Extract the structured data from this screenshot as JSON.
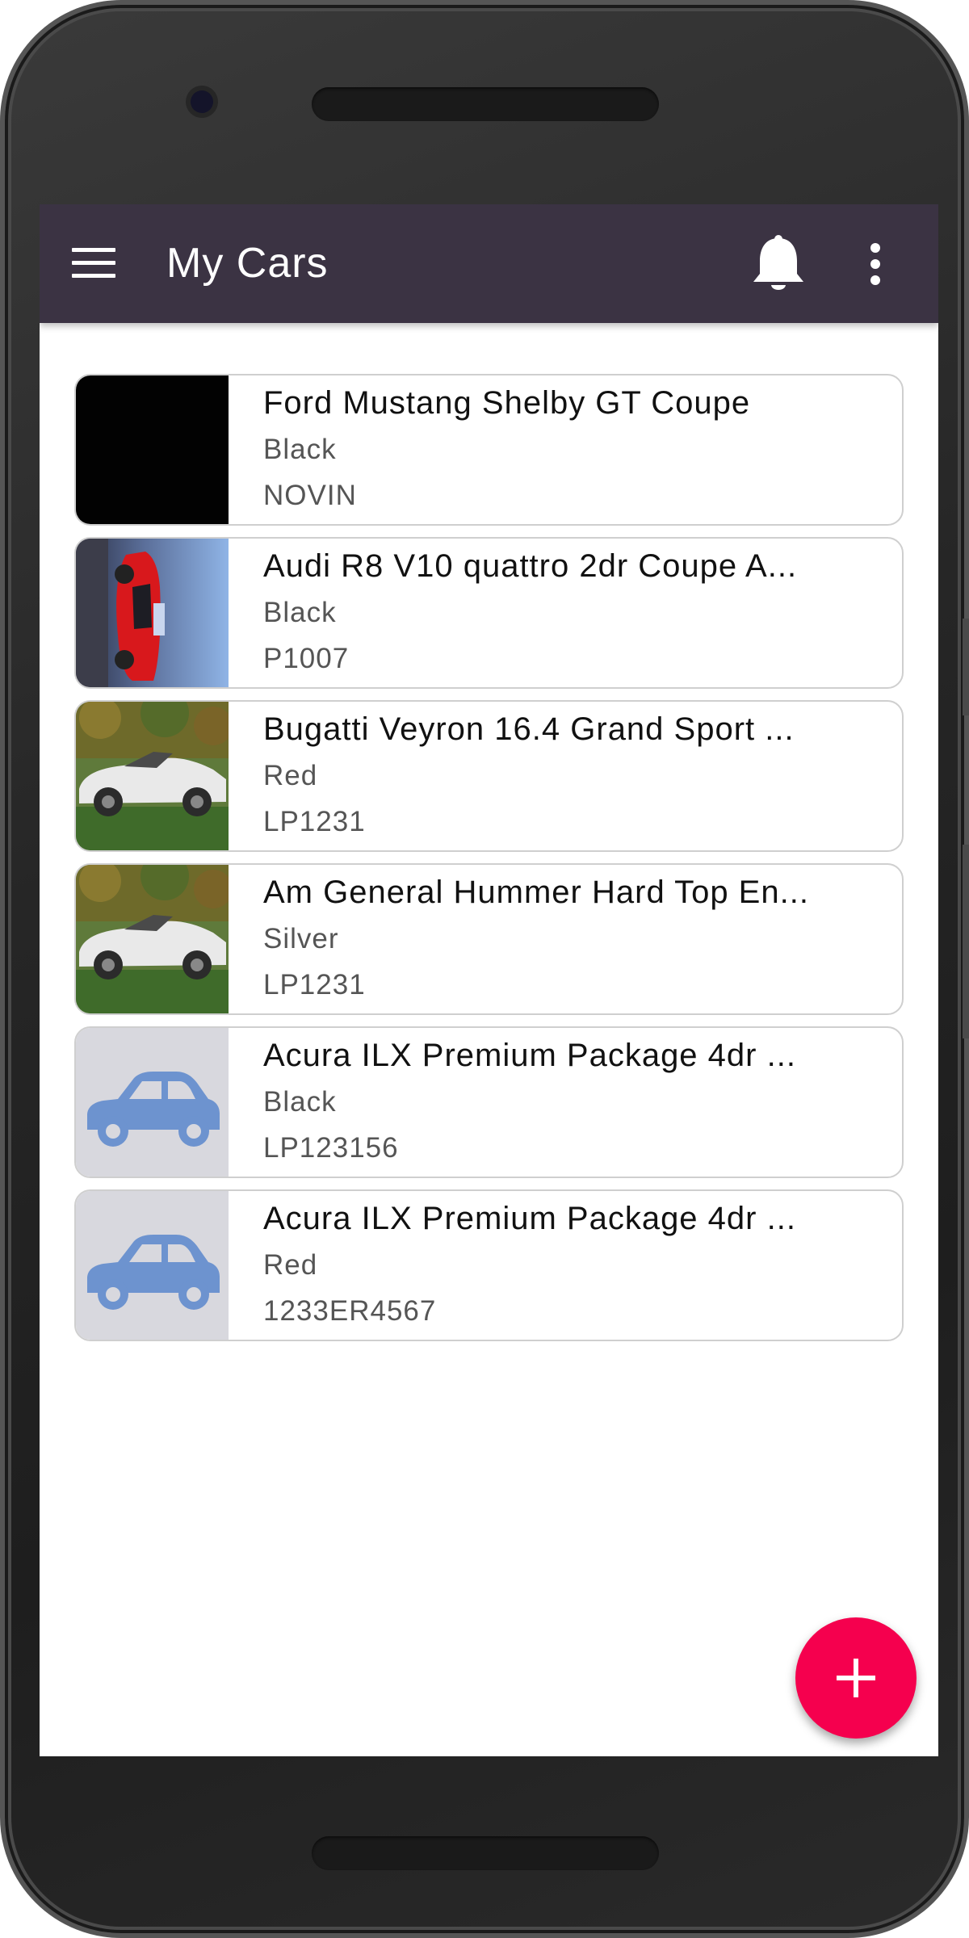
{
  "app": {
    "title": "My Cars"
  },
  "icons": {
    "menu": "menu-icon",
    "notifications": "bell-icon",
    "more": "more-vertical-icon",
    "add": "plus-icon",
    "placeholder": "car-icon"
  },
  "colors": {
    "appbar": "#3b3343",
    "fab": "#f5004e",
    "placeholder_bg": "#d8d8de",
    "placeholder_icon": "#6d93cf"
  },
  "cars": [
    {
      "name": "Ford Mustang Shelby GT Coupe",
      "color": "Black",
      "plate": "NOVIN",
      "thumbnail": "black-photo"
    },
    {
      "name": "Audi R8 V10 quattro 2dr Coupe A...",
      "color": "Black",
      "plate": "P1007",
      "thumbnail": "red-sports-car-photo"
    },
    {
      "name": "Bugatti Veyron 16.4 Grand Sport ...",
      "color": "Red",
      "plate": "LP1231",
      "thumbnail": "white-convertible-photo"
    },
    {
      "name": "Am General Hummer Hard Top En...",
      "color": "Silver",
      "plate": "LP1231",
      "thumbnail": "white-convertible-photo"
    },
    {
      "name": "Acura ILX Premium Package 4dr ...",
      "color": "Black",
      "plate": "LP123156",
      "thumbnail": "car-placeholder"
    },
    {
      "name": "Acura ILX Premium Package 4dr ...",
      "color": "Red",
      "plate": "1233ER4567",
      "thumbnail": "car-placeholder"
    }
  ]
}
